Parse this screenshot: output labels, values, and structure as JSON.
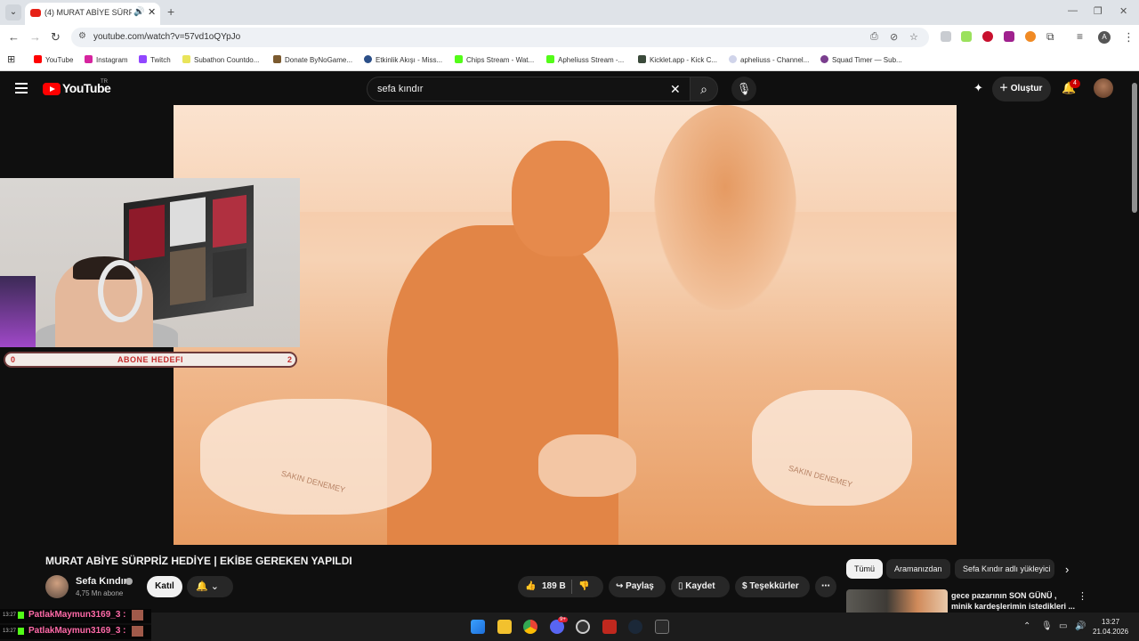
{
  "browser": {
    "tab_title": "(4) MURAT ABİYE SÜRPRİZ",
    "url": "youtube.com/watch?v=57vd1oQYpJo",
    "profile_initial": "A",
    "bookmarks": [
      "YouTube",
      "Instagram",
      "Twitch",
      "Subathon Countdo...",
      "Donate ByNoGame...",
      "Etkinlik Akışı - Miss...",
      "Chips Stream - Wat...",
      "Apheliuss Stream -...",
      "Kicklet.app - Kick C...",
      "apheliuss - Channel...",
      "Squad Timer — Sub..."
    ]
  },
  "youtube": {
    "logo_text": "YouTube",
    "country": "TR",
    "search_value": "sefa kındır",
    "create_label": "Oluştur",
    "notification_count": "4"
  },
  "overlay": {
    "goal_left": "0",
    "goal_label": "ABONE HEDEFI",
    "goal_right": "2"
  },
  "video": {
    "title": "MURAT ABİYE SÜRPRİZ HEDİYE | EKİBE GEREKEN YAPILDI",
    "channel": "Sefa Kındır",
    "subscribers": "4,75 Mn abone",
    "join_label": "Katıl",
    "likes": "189 B",
    "share_label": "Paylaş",
    "save_label": "Kaydet",
    "thanks_label": "Teşekkürler",
    "stone_text_left": "SAKIN DENEMEY",
    "stone_text_right": "SAKIN DENEMEY"
  },
  "filters": [
    "Tümü",
    "Aramanızdan",
    "Sefa Kındır adlı yükleyici"
  ],
  "suggestion": {
    "title": "gece pazarının SON GÜNÜ , minik kardeşlerimin istedikleri ..."
  },
  "chat": [
    {
      "time": "13:27",
      "user": "PatlakMaymun3169_3 :"
    },
    {
      "time": "13:27",
      "user": "PatlakMaymun3169_3 :"
    }
  ],
  "taskbar": {
    "time": "13:27",
    "date": "21.04.2026",
    "discord_badge": "9+"
  },
  "colors": {
    "youtube_red": "#ff0000",
    "accent_pink": "#ff6aa8",
    "kick_green": "#53fc18"
  }
}
